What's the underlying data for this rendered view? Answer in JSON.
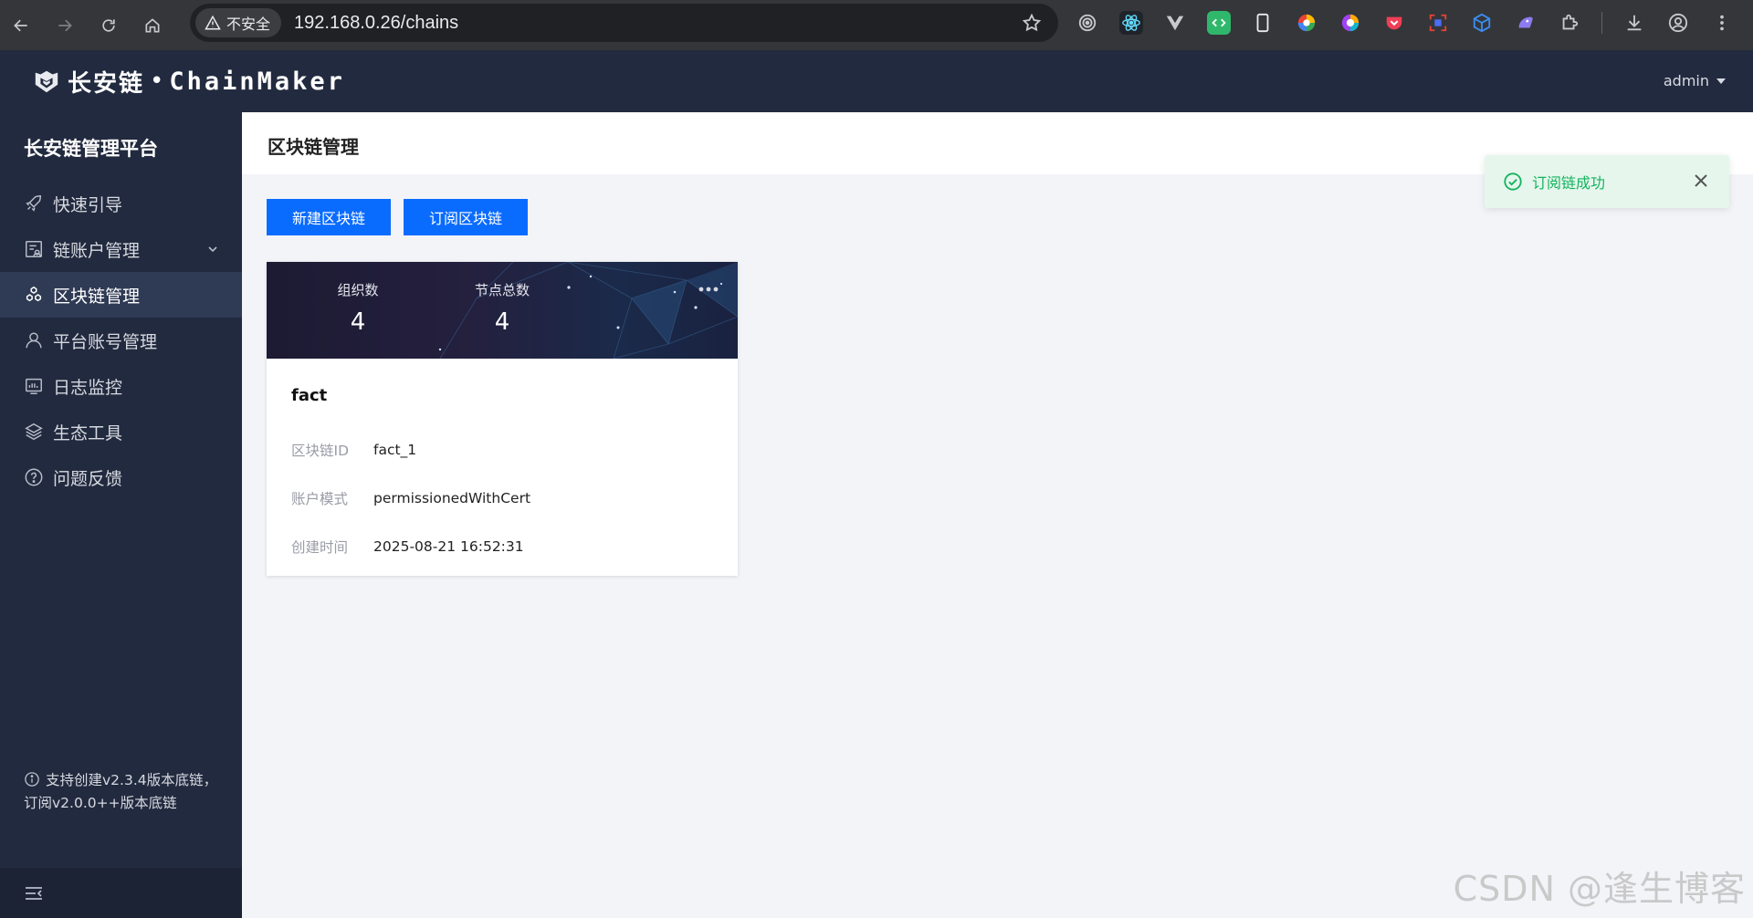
{
  "browser": {
    "security_label": "不安全",
    "url": "192.168.0.26/chains"
  },
  "header": {
    "brand_cn": "长安链",
    "brand_dot": "•",
    "brand_en": "ChainMaker",
    "user": "admin"
  },
  "sidebar": {
    "title": "长安链管理平台",
    "items": [
      {
        "label": "快速引导",
        "icon": "rocket-icon"
      },
      {
        "label": "链账户管理",
        "icon": "account-doc-icon"
      },
      {
        "label": "区块链管理",
        "icon": "blockchain-icon"
      },
      {
        "label": "平台账号管理",
        "icon": "user-icon"
      },
      {
        "label": "日志监控",
        "icon": "monitor-icon"
      },
      {
        "label": "生态工具",
        "icon": "layers-icon"
      },
      {
        "label": "问题反馈",
        "icon": "help-icon"
      }
    ],
    "active_index": 2,
    "note": "支持创建v2.3.4版本底链， 订阅v2.0.0++版本底链"
  },
  "main": {
    "page_title": "区块链管理",
    "new_chain_label": "新建区块链",
    "subscribe_label": "订阅区块链"
  },
  "card": {
    "org_label": "组织数",
    "org_count": "4",
    "node_label": "节点总数",
    "node_count": "4",
    "name": "fact",
    "fields": [
      {
        "label": "区块链ID",
        "value": "fact_1"
      },
      {
        "label": "账户模式",
        "value": "permissionedWithCert"
      },
      {
        "label": "创建时间",
        "value": "2025-08-21 16:52:31"
      }
    ]
  },
  "toast": {
    "message": "订阅链成功"
  },
  "watermark": "CSDN @逢生博客"
}
